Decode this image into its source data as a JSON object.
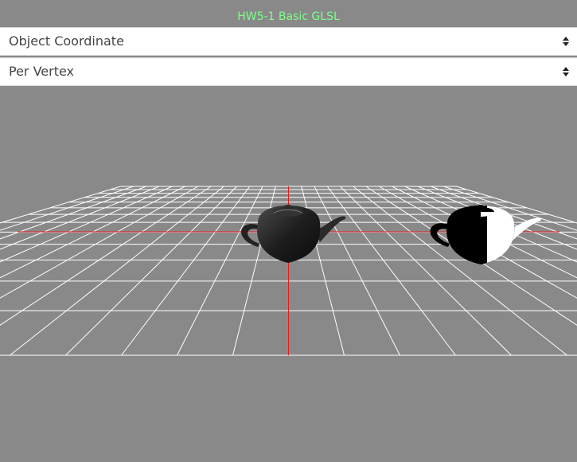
{
  "title": "HW5-1 Basic GLSL",
  "coordinate_select": {
    "value": "Object Coordinate"
  },
  "shading_select": {
    "value": "Per Vertex"
  },
  "colors": {
    "background": "#898989",
    "title": "#7dff8a",
    "grid": "#ffffff",
    "axis": "#e21b1b"
  },
  "scene": {
    "objects": [
      "teapot-shaded-left",
      "teapot-silhouette-right"
    ]
  }
}
